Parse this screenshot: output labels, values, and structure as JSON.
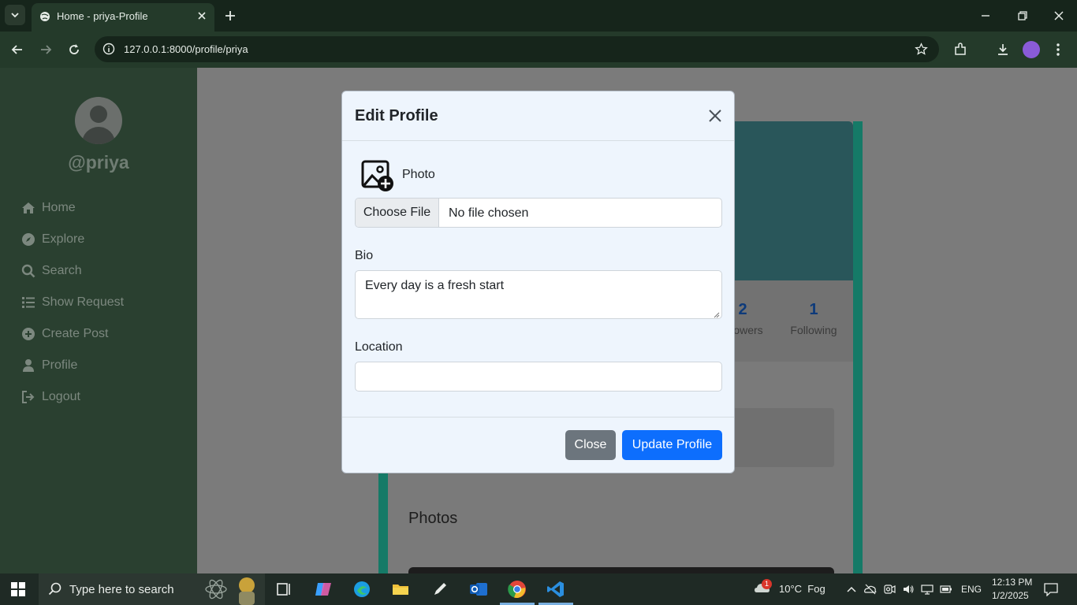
{
  "browser": {
    "tab_title": "Home - priya-Profile",
    "url": "127.0.0.1:8000/profile/priya"
  },
  "sidebar": {
    "username": "@priya",
    "items": [
      {
        "label": "Home",
        "icon": "house-icon"
      },
      {
        "label": "Explore",
        "icon": "compass-icon"
      },
      {
        "label": "Search",
        "icon": "search-icon"
      },
      {
        "label": "Show Request",
        "icon": "list-icon"
      },
      {
        "label": "Create Post",
        "icon": "plus-circle-icon"
      },
      {
        "label": "Profile",
        "icon": "person-icon"
      },
      {
        "label": "Logout",
        "icon": "logout-icon"
      }
    ]
  },
  "profile": {
    "followers_count": "2",
    "followers_label": "ollowers",
    "following_count": "1",
    "following_label": "Following",
    "photos_title": "Photos"
  },
  "modal": {
    "title": "Edit Profile",
    "photo_label": "Photo",
    "file_button": "Choose File",
    "file_status": "No file chosen",
    "bio_label": "Bio",
    "bio_value": "Every day is a fresh start",
    "location_label": "Location",
    "location_value": "",
    "close_button": "Close",
    "update_button": "Update Profile"
  },
  "taskbar": {
    "search_placeholder": "Type here to search",
    "weather_badge": "1",
    "weather": "10°C  Fog",
    "language": "ENG",
    "time": "12:13 PM",
    "date": "1/2/2025"
  },
  "colors": {
    "accent_blue": "#0d6efd",
    "secondary_gray": "#6c757d",
    "sidebar_green": "#2a4030",
    "card_border_teal": "#157a67"
  }
}
